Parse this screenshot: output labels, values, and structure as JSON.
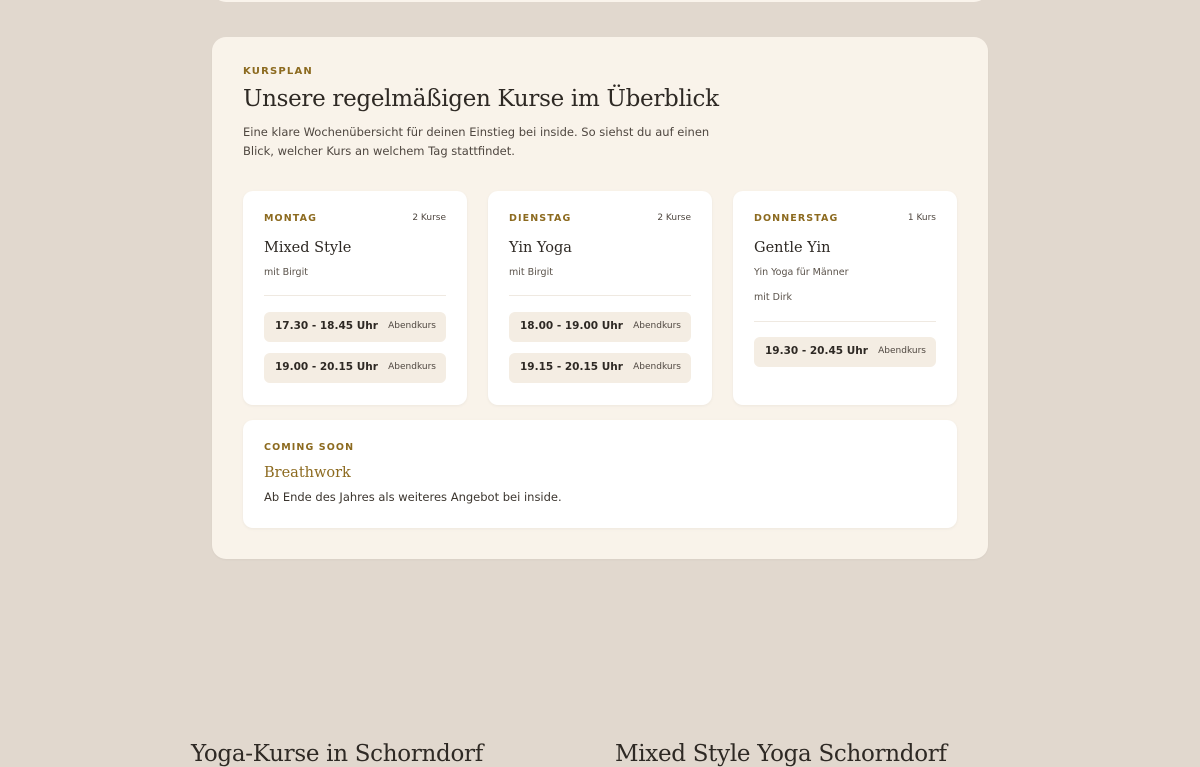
{
  "schedule": {
    "eyebrow": "KURSPLAN",
    "title": "Unsere regelmäßigen Kurse im Überblick",
    "intro": "Eine klare Wochenübersicht für deinen Einstieg bei inside. So siehst du auf einen Blick, welcher Kurs an welchem Tag stattfindet.",
    "days": [
      {
        "day": "MONTAG",
        "count": "2 Kurse",
        "course": "Mixed Style",
        "teacher": "mit Birgit",
        "slots": [
          {
            "time": "17.30 - 18.45 Uhr",
            "type": "Abendkurs"
          },
          {
            "time": "19.00 - 20.15 Uhr",
            "type": "Abendkurs"
          }
        ]
      },
      {
        "day": "DIENSTAG",
        "count": "2 Kurse",
        "course": "Yin Yoga",
        "teacher": "mit Birgit",
        "slots": [
          {
            "time": "18.00 - 19.00 Uhr",
            "type": "Abendkurs"
          },
          {
            "time": "19.15 - 20.15 Uhr",
            "type": "Abendkurs"
          }
        ]
      },
      {
        "day": "DONNERSTAG",
        "count": "1 Kurs",
        "course": "Gentle Yin",
        "subtitle": "Yin Yoga für Männer",
        "teacher": "mit Dirk",
        "slots": [
          {
            "time": "19.30 - 20.45 Uhr",
            "type": "Abendkurs"
          }
        ]
      }
    ],
    "coming_soon": {
      "label": "COMING SOON",
      "title": "Breathwork",
      "text": "Ab Ende des Jahres als weiteres Angebot bei inside."
    }
  },
  "bottom": {
    "left_heading": "Yoga-Kurse in Schorndorf",
    "right_heading": "Mixed Style Yoga Schorndorf"
  }
}
